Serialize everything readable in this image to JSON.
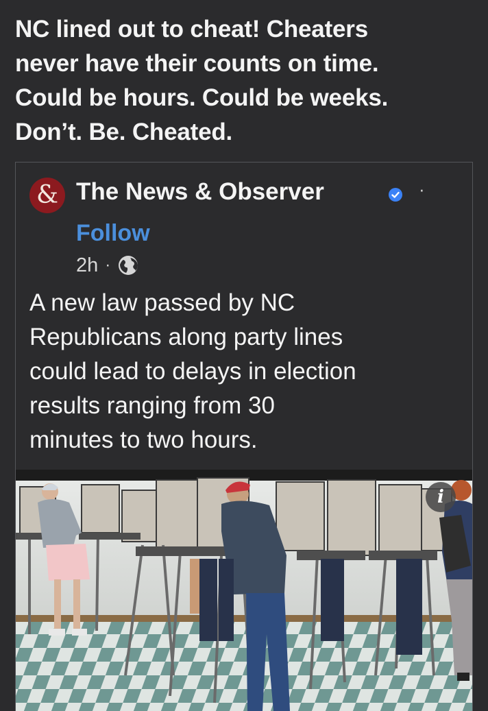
{
  "post": {
    "lines": [
      "NC lined out to cheat! Cheaters",
      "never have their counts on time.",
      "Could be hours. Could be weeks.",
      "Don’t. Be. Cheated."
    ]
  },
  "shared": {
    "avatar_glyph": "&",
    "page_name": "The News & Observer",
    "verified_icon": "verified-badge-icon",
    "header_dot": "·",
    "follow_label": "Follow",
    "time": "2h",
    "meta_sep": "·",
    "privacy_icon": "globe-icon",
    "article_lines": [
      "A new law passed by NC",
      "Republicans along party lines",
      "could lead to delays in election",
      "results ranging from 30",
      "minutes to two hours."
    ],
    "photo_icon": "voting-booths-photo",
    "info_glyph": "i"
  },
  "colors": {
    "background": "#2b2b2d",
    "text": "#f4f4f4",
    "follow": "#4b8fdc",
    "avatar": "#8c1a1f",
    "verified": "#3b82f6"
  }
}
